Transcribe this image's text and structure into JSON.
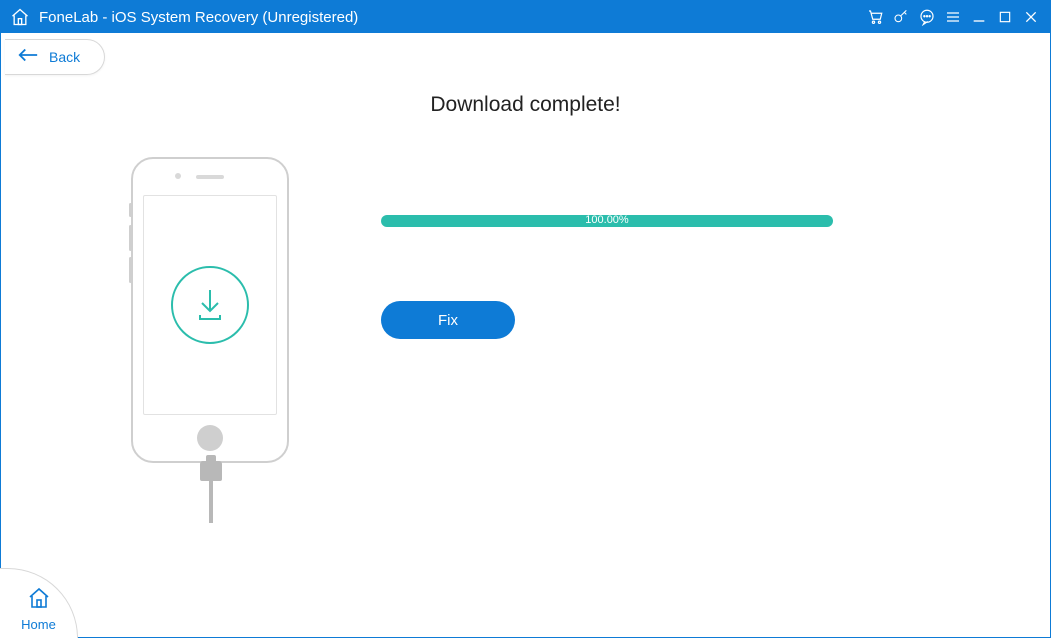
{
  "window": {
    "title": "FoneLab - iOS System Recovery (Unregistered)"
  },
  "nav": {
    "back_label": "Back",
    "home_label": "Home"
  },
  "main": {
    "heading": "Download complete!",
    "progress_percent": "100.00%",
    "fix_button_label": "Fix"
  },
  "colors": {
    "brand": "#0e7bd6",
    "accent": "#2bbdac"
  },
  "titlebar_icons": [
    "cart-icon",
    "key-icon",
    "chat-icon",
    "menu-icon",
    "minimize-icon",
    "maximize-icon",
    "close-icon"
  ]
}
